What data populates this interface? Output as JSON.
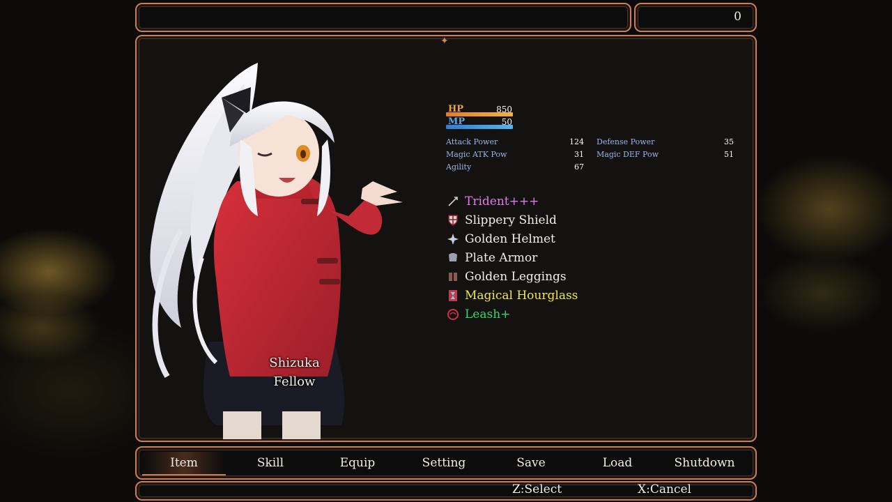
{
  "gold": {
    "value": "0"
  },
  "actor": {
    "name": "Shizuka",
    "class": "Fellow",
    "hp": {
      "label": "HP",
      "value": "850",
      "fill": 1.0
    },
    "mp": {
      "label": "MP",
      "value": "50",
      "fill": 1.0
    },
    "params": [
      {
        "label": "Attack Power",
        "value": "124"
      },
      {
        "label": "Defense Power",
        "value": "35"
      },
      {
        "label": "Magic ATK Pow",
        "value": "31"
      },
      {
        "label": "Magic DEF Pow",
        "value": "51"
      },
      {
        "label": "Agility",
        "value": "67"
      }
    ],
    "equipment": [
      {
        "name": "Trident+++",
        "icon": "trident-icon",
        "color": "#e27ae8"
      },
      {
        "name": "Slippery Shield",
        "icon": "shield-icon",
        "color": "#f2efe6"
      },
      {
        "name": "Golden Helmet",
        "icon": "helmet-icon",
        "color": "#f2efe6"
      },
      {
        "name": "Plate Armor",
        "icon": "armor-icon",
        "color": "#f2efe6"
      },
      {
        "name": "Golden Leggings",
        "icon": "leggings-icon",
        "color": "#f2efe6"
      },
      {
        "name": "Magical Hourglass",
        "icon": "hourglass-icon",
        "color": "#f1e64a"
      },
      {
        "name": "Leash+",
        "icon": "leash-icon",
        "color": "#2fd86a"
      }
    ]
  },
  "menu": {
    "commands": [
      "Item",
      "Skill",
      "Equip",
      "Setting",
      "Save",
      "Load",
      "Shutdown"
    ],
    "selected": "Item"
  },
  "help": {
    "select": "Z:Select",
    "cancel": "X:Cancel"
  }
}
